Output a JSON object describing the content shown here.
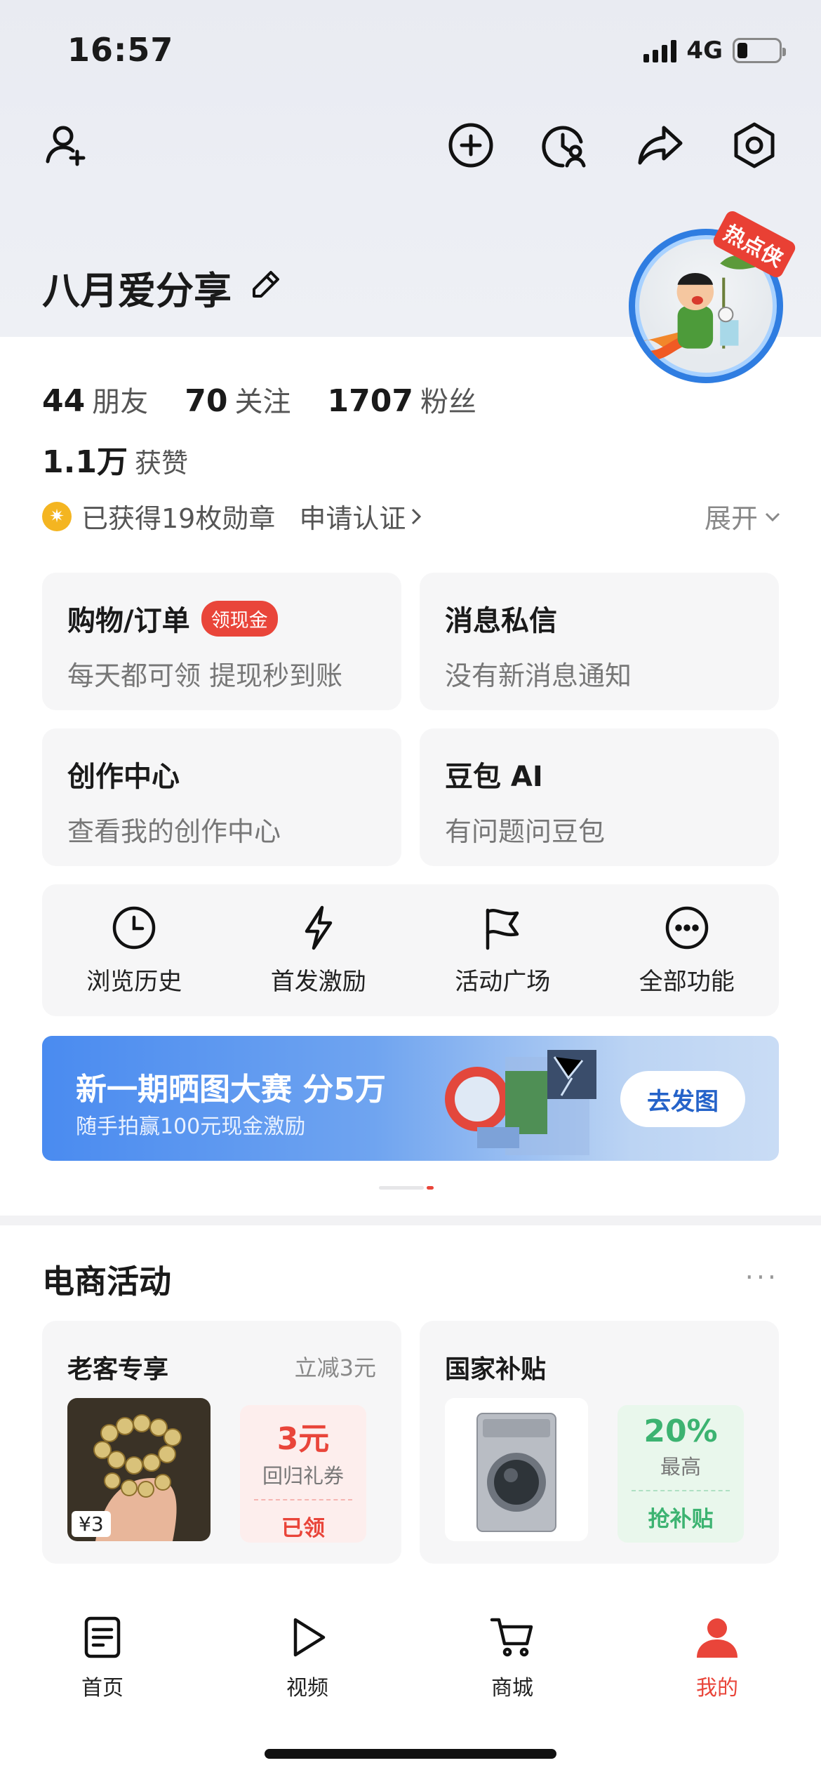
{
  "status_bar": {
    "time": "16:57",
    "network": "4G",
    "battery_level": 0.25
  },
  "profile": {
    "username": "八月爱分享",
    "avatar_badge": "热点侠"
  },
  "stats": [
    {
      "value": "44",
      "label": "朋友"
    },
    {
      "value": "70",
      "label": "关注"
    },
    {
      "value": "1707",
      "label": "粉丝"
    }
  ],
  "likes": {
    "value": "1.1万",
    "label": "获赞"
  },
  "badges": {
    "text": "已获得19枚勋章",
    "apply": "申请认证",
    "expand": "展开"
  },
  "tiles": [
    {
      "title": "购物/订单",
      "pill": "领现金",
      "subtitle": "每天都可领 提现秒到账"
    },
    {
      "title": "消息私信",
      "subtitle": "没有新消息通知"
    },
    {
      "title": "创作中心",
      "subtitle": "查看我的创作中心"
    },
    {
      "title": "豆包 AI",
      "subtitle": "有问题问豆包"
    }
  ],
  "quick_actions": [
    {
      "label": "浏览历史",
      "icon": "clock-icon"
    },
    {
      "label": "首发激励",
      "icon": "lightning-icon"
    },
    {
      "label": "活动广场",
      "icon": "flag-icon"
    },
    {
      "label": "全部功能",
      "icon": "more-circle-icon"
    }
  ],
  "banner": {
    "title": "新一期晒图大赛 分5万",
    "subtitle": "随手拍赢100元现金激励",
    "button": "去发图"
  },
  "ecommerce": {
    "title": "电商活动",
    "more": "···",
    "cards": [
      {
        "title": "老客专享",
        "tag": "立减3元",
        "price": "¥3",
        "coupon_value": "3元",
        "coupon_label": "回归礼券",
        "coupon_action": "已领",
        "color": "#e9453a"
      },
      {
        "title": "国家补贴",
        "coupon_value": "20%",
        "coupon_label": "最高",
        "coupon_action": "抢补贴",
        "color": "#3cb371"
      }
    ]
  },
  "tabbar": [
    {
      "label": "首页",
      "icon": "home-doc-icon"
    },
    {
      "label": "视频",
      "icon": "play-icon"
    },
    {
      "label": "商城",
      "icon": "cart-icon"
    },
    {
      "label": "我的",
      "icon": "user-icon",
      "active": true
    }
  ],
  "colors": {
    "accent": "#e9453a",
    "active_tab": "#e9453a",
    "green": "#3cb371",
    "banner_blue": "#4a8bf0"
  }
}
